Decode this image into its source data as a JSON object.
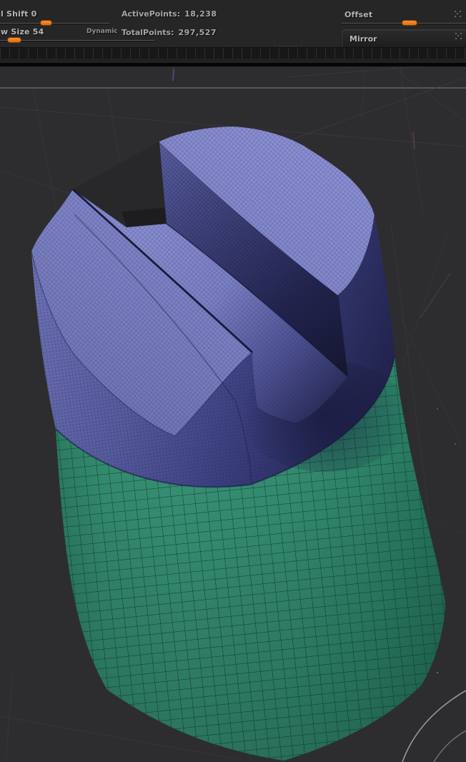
{
  "topbar": {
    "focal_shift": {
      "label": "l Shift 0"
    },
    "draw_size": {
      "label": "w Size 54"
    },
    "dynamic_label": "Dynamic",
    "active_points": {
      "label": "ActivePoints:",
      "value": "18,238"
    },
    "total_points": {
      "label": "TotalPoints:",
      "value": "297,527"
    },
    "offset": {
      "label": "Offset"
    },
    "mirror": {
      "label": "Mirror"
    }
  },
  "icons": {
    "offset_widget": "drag-dots",
    "mirror_widget": "drag-dots"
  },
  "colors": {
    "accent_orange": "#ee7817",
    "topbar_bg": "#262626",
    "canvas_bg": "#2d2d30",
    "horizon_line": "#8e8e91",
    "mesh_top_purple": "#7e83c6",
    "mesh_band_purple": "#565b9d",
    "slot_wall_navy": "#1b1d42",
    "mesh_body_green": "#36957a",
    "wireframe_dark": "#262a60"
  }
}
